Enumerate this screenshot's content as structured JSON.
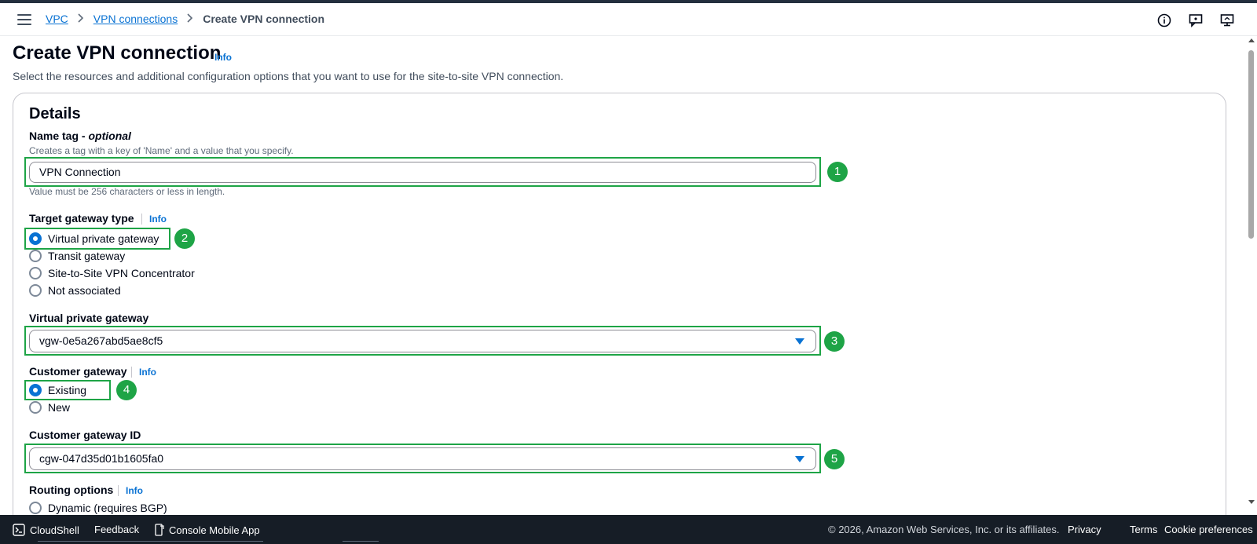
{
  "breadcrumb": {
    "items": [
      "VPC",
      "VPN connections"
    ],
    "current": "Create VPN connection"
  },
  "header_icons": [
    "info-circle-icon",
    "feedback-icon",
    "presentation-icon"
  ],
  "page": {
    "title": "Create VPN connection",
    "title_info": "Info",
    "description": "Select the resources and additional configuration options that you want to use for the site-to-site VPN connection."
  },
  "details": {
    "title": "Details",
    "name_tag": {
      "label": "Name tag",
      "label_optional": "optional",
      "description": "Creates a tag with a key of 'Name' and a value that you specify.",
      "value": "VPN Connection",
      "constraint": "Value must be 256 characters or less in length."
    },
    "target_gateway_type": {
      "label": "Target gateway type",
      "info": "Info",
      "options": [
        "Virtual private gateway",
        "Transit gateway",
        "Site-to-Site VPN Concentrator",
        "Not associated"
      ],
      "selected": "Virtual private gateway"
    },
    "virtual_private_gateway": {
      "label": "Virtual private gateway",
      "value": "vgw-0e5a267abd5ae8cf5"
    },
    "customer_gateway": {
      "label": "Customer gateway",
      "info": "Info",
      "options": [
        "Existing",
        "New"
      ],
      "selected": "Existing"
    },
    "customer_gateway_id": {
      "label": "Customer gateway ID",
      "value": "cgw-047d35d01b1605fa0"
    },
    "routing_options": {
      "label": "Routing options",
      "info": "Info",
      "options": [
        "Dynamic (requires BGP)"
      ]
    }
  },
  "annotations": [
    "1",
    "2",
    "3",
    "4",
    "5"
  ],
  "annotation_color": "#1ea446",
  "accent_color": "#0972d3",
  "footer": {
    "cloudshell": "CloudShell",
    "feedback": "Feedback",
    "mobile_app": "Console Mobile App",
    "copyright": "© 2026, Amazon Web Services, Inc. or its affiliates.",
    "privacy": "Privacy",
    "terms": "Terms",
    "cookies": "Cookie preferences"
  }
}
